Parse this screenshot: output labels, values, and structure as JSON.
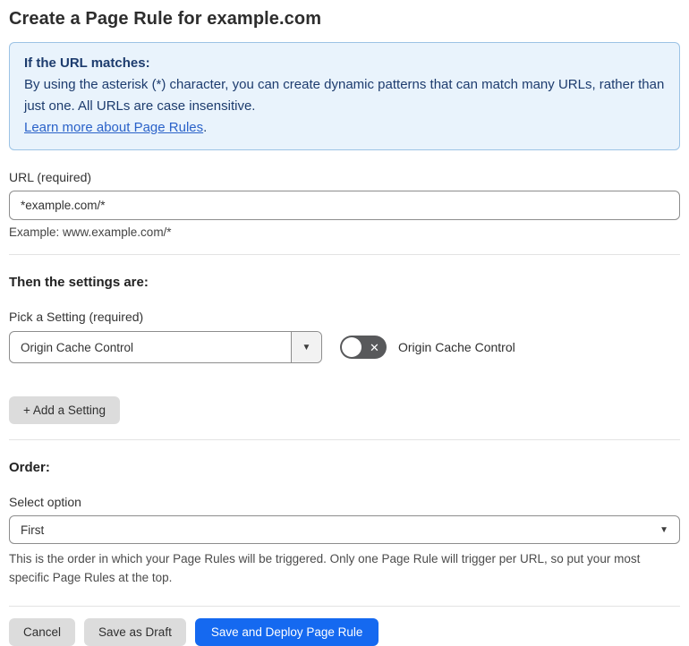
{
  "page": {
    "title": "Create a Page Rule for example.com"
  },
  "info_box": {
    "heading": "If the URL matches:",
    "body": "By using the asterisk (*) character, you can create dynamic patterns that can match many URLs, rather than just one. All URLs are case insensitive.",
    "link": "Learn more about Page Rules",
    "link_suffix": "."
  },
  "url_section": {
    "label": "URL (required)",
    "value": "*example.com/*",
    "example": "Example: www.example.com/*"
  },
  "settings_section": {
    "heading": "Then the settings are:",
    "pick_label": "Pick a Setting (required)",
    "selected_setting": "Origin Cache Control",
    "toggle_label": "Origin Cache Control",
    "add_button": "+ Add a Setting"
  },
  "order_section": {
    "heading": "Order:",
    "label": "Select option",
    "selected_option": "First",
    "help": "This is the order in which your Page Rules will be triggered. Only one Page Rule will trigger per URL, so put your most specific Page Rules at the top."
  },
  "actions": {
    "cancel": "Cancel",
    "save_draft": "Save as Draft",
    "save_deploy": "Save and Deploy Page Rule"
  },
  "icons": {
    "dropdown_caret": "▼",
    "toggle_off_x": "✕"
  },
  "colors": {
    "info_bg": "#e9f3fc",
    "info_border": "#9cc3e5",
    "info_text": "#1d3c6e",
    "link": "#2a62c9",
    "toggle_off_bg": "#58595b",
    "primary_button": "#1569f0",
    "secondary_button": "#dcdcdc"
  }
}
